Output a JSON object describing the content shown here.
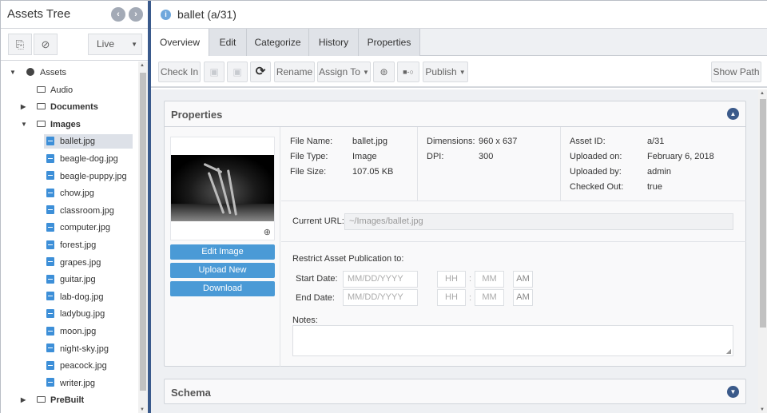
{
  "sidebar": {
    "title": "Assets Tree",
    "nav_prev_icon": "chevron-left-icon",
    "nav_next_icon": "chevron-right-icon",
    "tool_icons": [
      "translate-icon",
      "eye-slash-icon"
    ],
    "mode_select": {
      "value": "Live"
    },
    "tree": [
      {
        "label": "Assets",
        "type": "root",
        "expanded": true,
        "level": 0
      },
      {
        "label": "Audio",
        "type": "folder",
        "level": 1
      },
      {
        "label": "Documents",
        "type": "folder",
        "collapsed": true,
        "bold": true,
        "level": 1
      },
      {
        "label": "Images",
        "type": "folder",
        "expanded": true,
        "bold": true,
        "level": 1
      },
      {
        "label": "ballet.jpg",
        "type": "image",
        "selected": true,
        "level": 2
      },
      {
        "label": "beagle-dog.jpg",
        "type": "image",
        "level": 2
      },
      {
        "label": "beagle-puppy.jpg",
        "type": "image",
        "level": 2
      },
      {
        "label": "chow.jpg",
        "type": "image",
        "level": 2
      },
      {
        "label": "classroom.jpg",
        "type": "image",
        "level": 2
      },
      {
        "label": "computer.jpg",
        "type": "image",
        "level": 2
      },
      {
        "label": "forest.jpg",
        "type": "image",
        "level": 2
      },
      {
        "label": "grapes.jpg",
        "type": "image",
        "level": 2
      },
      {
        "label": "guitar.jpg",
        "type": "image",
        "level": 2
      },
      {
        "label": "lab-dog.jpg",
        "type": "image",
        "level": 2
      },
      {
        "label": "ladybug.jpg",
        "type": "image",
        "level": 2
      },
      {
        "label": "moon.jpg",
        "type": "image",
        "level": 2
      },
      {
        "label": "night-sky.jpg",
        "type": "image",
        "level": 2
      },
      {
        "label": "peacock.jpg",
        "type": "image",
        "level": 2
      },
      {
        "label": "writer.jpg",
        "type": "image",
        "level": 2
      },
      {
        "label": "PreBuilt",
        "type": "folder",
        "collapsed": true,
        "bold": true,
        "level": 1
      }
    ]
  },
  "header": {
    "title": "ballet (a/31)",
    "icon": "info-icon"
  },
  "tabs": [
    {
      "label": "Overview",
      "active": true
    },
    {
      "label": "Edit"
    },
    {
      "label": "Categorize"
    },
    {
      "label": "History"
    },
    {
      "label": "Properties"
    }
  ],
  "toolbar": {
    "check_in": "Check In",
    "save_icon": "save-icon",
    "save_new_icon": "save-new-icon",
    "refresh_icon": "refresh-icon",
    "rename": "Rename",
    "assign_to": "Assign To",
    "workflow_icon": "workflow-icon",
    "connect_icon": "connector-icon",
    "publish": "Publish",
    "show_path": "Show Path"
  },
  "properties_panel": {
    "title": "Properties",
    "buttons": {
      "edit_image": "Edit Image",
      "upload_new": "Upload New",
      "download": "Download"
    },
    "file": {
      "name_label": "File Name:",
      "name": "ballet.jpg",
      "type_label": "File Type:",
      "type": "Image",
      "size_label": "File Size:",
      "size": "107.05 KB"
    },
    "image": {
      "dimensions_label": "Dimensions:",
      "dimensions": "960 x 637",
      "dpi_label": "DPI:",
      "dpi": "300"
    },
    "asset": {
      "id_label": "Asset ID:",
      "id": "a/31",
      "uploaded_on_label": "Uploaded on:",
      "uploaded_on": "February 6, 2018",
      "uploaded_by_label": "Uploaded by:",
      "uploaded_by": "admin",
      "checked_out_label": "Checked Out:",
      "checked_out": "true"
    },
    "current_url_label": "Current URL:",
    "current_url": "~/Images/ballet.jpg",
    "restrict_label": "Restrict Asset Publication to:",
    "start_date_label": "Start Date:",
    "end_date_label": "End Date:",
    "date_placeholder": "MM/DD/YYYY",
    "hour_placeholder": "HH",
    "minute_placeholder": "MM",
    "time_sep": ":",
    "ampm": "AM",
    "notes_label": "Notes:",
    "notes_value": ""
  },
  "schema_panel": {
    "title": "Schema"
  }
}
